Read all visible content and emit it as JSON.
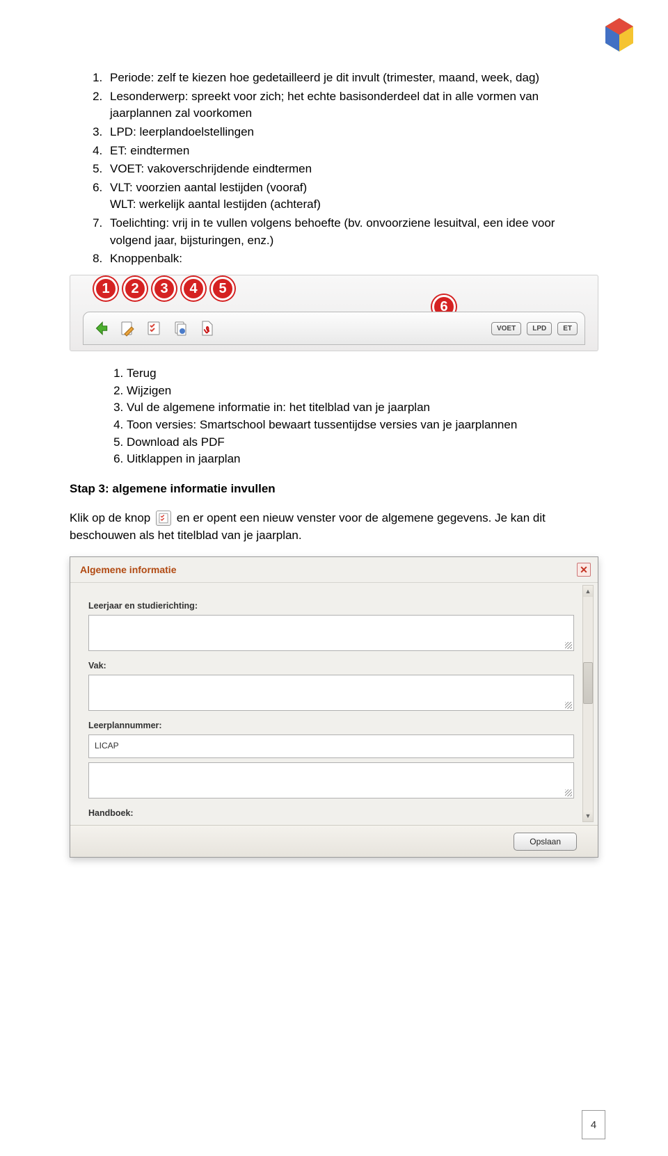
{
  "main_list": [
    "Periode: zelf te kiezen hoe gedetailleerd je dit invult (trimester, maand, week, dag)",
    "Lesonderwerp: spreekt voor zich; het echte basisonderdeel dat in alle vormen van jaarplannen zal voorkomen",
    "LPD: leerplandoelstellingen",
    "ET: eindtermen",
    "VOET: vakoverschrijdende eindtermen",
    "VLT: voorzien aantal lestijden (vooraf)\nWLT: werkelijk aantal lestijden (achteraf)",
    "Toelichting: vrij in te vullen volgens behoefte (bv. onvoorziene lesuitval, een idee voor volgend jaar, bijsturingen, enz.)",
    "Knoppenbalk:"
  ],
  "toolbar": {
    "badges": [
      "1",
      "2",
      "3",
      "4",
      "5",
      "6"
    ],
    "pills": [
      "VOET",
      "LPD",
      "ET"
    ]
  },
  "sub_list": [
    "Terug",
    "Wijzigen",
    "Vul de algemene informatie in: het titelblad van je jaarplan",
    "Toon versies: Smartschool bewaart tussentijdse versies van je jaarplannen",
    "Download als PDF",
    "Uitklappen in jaarplan"
  ],
  "step_heading": "Stap 3: algemene informatie invullen",
  "paragraph_before": "Klik op de knop ",
  "paragraph_after": " en er opent een nieuw venster voor de algemene gegevens. Je kan dit beschouwen als het titelblad van je jaarplan.",
  "dialog": {
    "title": "Algemene informatie",
    "fields": {
      "leerjaar_label": "Leerjaar en studierichting:",
      "leerjaar_value": "",
      "vak_label": "Vak:",
      "vak_value": "",
      "leerplannummer_label": "Leerplannummer:",
      "leerplannummer_value": "LICAP",
      "extra_value": "",
      "handboek_label": "Handboek:"
    },
    "save_button": "Opslaan"
  },
  "page_number": "4"
}
